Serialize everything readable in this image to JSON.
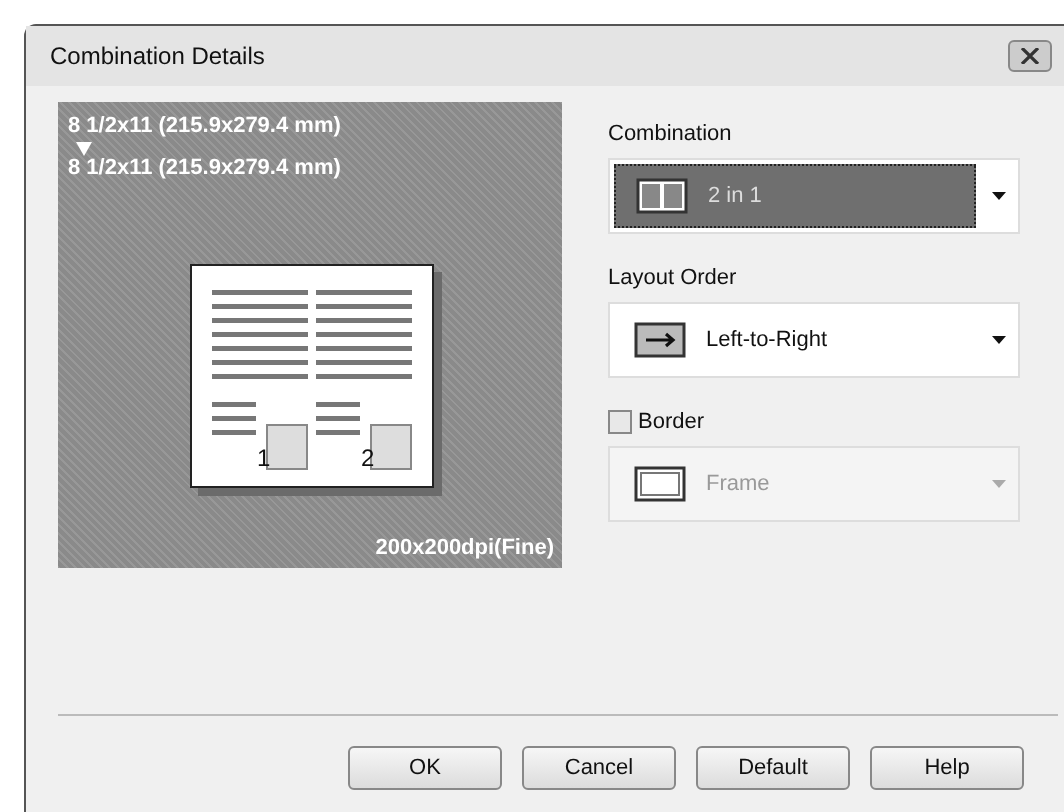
{
  "window": {
    "title": "Combination Details"
  },
  "preview": {
    "source_size": "8 1/2x11 (215.9x279.4 mm)",
    "target_size": "8 1/2x11 (215.9x279.4 mm)",
    "resolution": "200x200dpi(Fine)",
    "pages": [
      "1",
      "2"
    ]
  },
  "combination": {
    "label": "Combination",
    "value": "2 in 1",
    "focused": true
  },
  "layout_order": {
    "label": "Layout Order",
    "value": "Left-to-Right"
  },
  "border": {
    "label": "Border",
    "checked": false,
    "value": "Frame",
    "disabled": true
  },
  "buttons": [
    "OK",
    "Cancel",
    "Default",
    "Help"
  ]
}
